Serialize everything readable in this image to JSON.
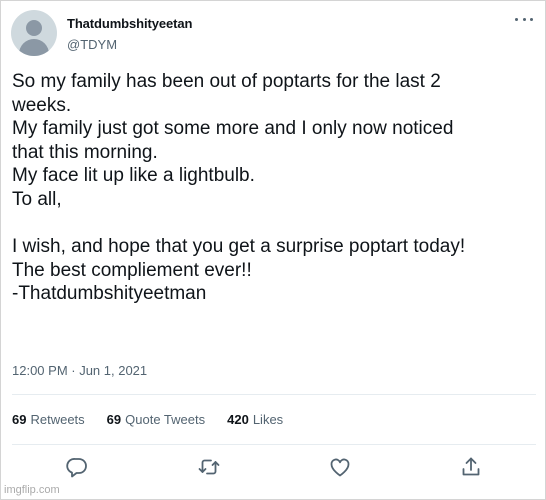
{
  "tweet": {
    "display_name": "Thatdumbshityeetan",
    "handle": "@TDYM",
    "text_lines": [
      "So my family has been out of poptarts for the last 2",
      "weeks.",
      "My family just got some more and I only now noticed",
      "that this morning.",
      "My face lit up like a lightbulb.",
      "To all,",
      "",
      "I wish, and hope that you get a surprise poptart today!",
      "The best compliement ever!!",
      "-Thatdumbshityeetman"
    ],
    "timestamp": "12:00 PM · Jun 1, 2021",
    "stats": {
      "retweets_count": "69",
      "retweets_label": "Retweets",
      "quotes_count": "69",
      "quotes_label": "Quote Tweets",
      "likes_count": "420",
      "likes_label": "Likes"
    },
    "actions": [
      "reply-icon",
      "retweet-icon",
      "like-icon",
      "share-icon"
    ]
  },
  "watermark": "imgflip.com",
  "colors": {
    "text_primary": "#0f1419",
    "text_secondary": "#536471",
    "divider": "#e6ecf0",
    "avatar_bg": "#cfd9de"
  }
}
